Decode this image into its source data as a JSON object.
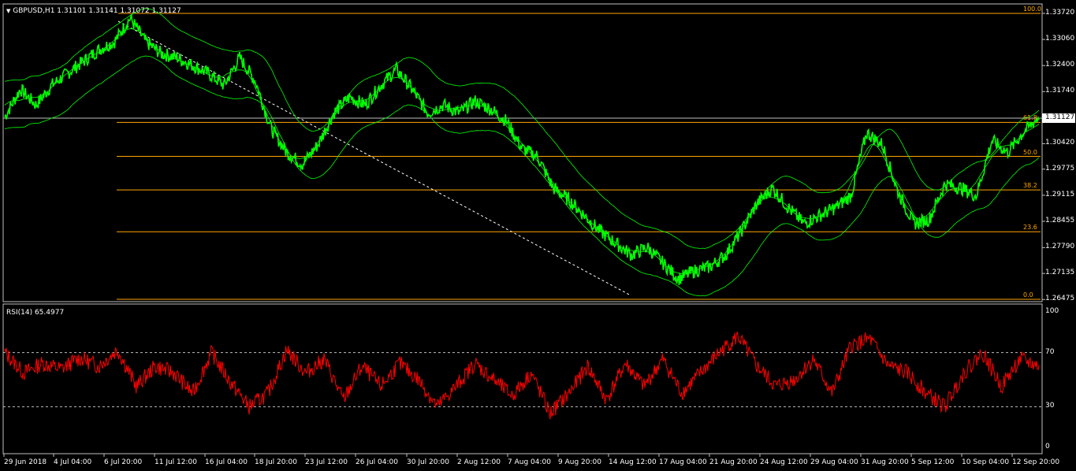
{
  "header": {
    "symbol_line": "GBPUSD,H1  1.31101 1.31141 1.31072 1.31127",
    "rsi_label": "RSI(14) 65.4977"
  },
  "price_axis": {
    "ticks": [
      "1.33720",
      "1.33060",
      "1.32400",
      "1.31740",
      "1.31127",
      "1.30420",
      "1.29775",
      "1.29115",
      "1.28455",
      "1.27790",
      "1.27135",
      "1.26475"
    ],
    "tick_values": [
      1.3372,
      1.3306,
      1.324,
      1.3174,
      1.31127,
      1.3042,
      1.29775,
      1.29115,
      1.28455,
      1.2779,
      1.27135,
      1.26475
    ],
    "current_price": "1.31127",
    "range": [
      1.2648,
      1.3372
    ]
  },
  "rsi_axis": {
    "ticks": [
      "100",
      "70",
      "30",
      "0"
    ],
    "levels": [
      70,
      30
    ]
  },
  "fib_levels": [
    {
      "label": "100.0",
      "price": 1.3372
    },
    {
      "label": "61.8",
      "price": 1.3096
    },
    {
      "label": "50.0",
      "price": 1.301
    },
    {
      "label": "38.2",
      "price": 1.2925
    },
    {
      "label": "23.6",
      "price": 1.2819
    },
    {
      "label": "0.0",
      "price": 1.2648
    }
  ],
  "time_axis": [
    "29 Jun 2018",
    "4 Jul 04:00",
    "6 Jul 20:00",
    "11 Jul 12:00",
    "16 Jul 04:00",
    "18 Jul 20:00",
    "23 Jul 12:00",
    "26 Jul 04:00",
    "30 Jul 20:00",
    "2 Aug 12:00",
    "7 Aug 04:00",
    "9 Aug 20:00",
    "14 Aug 12:00",
    "17 Aug 04:00",
    "21 Aug 20:00",
    "24 Aug 12:00",
    "29 Aug 04:00",
    "31 Aug 20:00",
    "5 Sep 12:00",
    "10 Sep 04:00",
    "12 Sep 20:00"
  ],
  "colors": {
    "price_line": "#00ff00",
    "bands": "#00ff00",
    "rsi_line": "#ff0000",
    "fib": "#ffa500",
    "grid_level": "#ffffff",
    "frame": "#c0c0c0"
  },
  "chart_data": {
    "type": "line",
    "title": "GBPUSD,H1",
    "series": [
      {
        "name": "GBPUSD,H1",
        "values": [
          1.311,
          1.318,
          1.314,
          1.319,
          1.322,
          1.325,
          1.328,
          1.33,
          1.336,
          1.33,
          1.327,
          1.326,
          1.324,
          1.322,
          1.319,
          1.326,
          1.32,
          1.308,
          1.302,
          1.299,
          1.304,
          1.312,
          1.316,
          1.314,
          1.319,
          1.323,
          1.318,
          1.312,
          1.314,
          1.312,
          1.315,
          1.313,
          1.31,
          1.303,
          1.301,
          1.293,
          1.29,
          1.286,
          1.282,
          1.279,
          1.276,
          1.278,
          1.274,
          1.27,
          1.272,
          1.273,
          1.276,
          1.282,
          1.289,
          1.293,
          1.288,
          1.284,
          1.286,
          1.288,
          1.291,
          1.307,
          1.304,
          1.292,
          1.284,
          1.285,
          1.294,
          1.293,
          1.291,
          1.305,
          1.302,
          1.307,
          1.311
        ]
      },
      {
        "name": "RSI(14)",
        "values": [
          70,
          55,
          62,
          58,
          66,
          60,
          72,
          45,
          60,
          55,
          40,
          70,
          48,
          30,
          40,
          72,
          55,
          65,
          35,
          60,
          45,
          62,
          50,
          30,
          45,
          62,
          50,
          38,
          55,
          25,
          40,
          60,
          35,
          62,
          45,
          65,
          40,
          55,
          70,
          82,
          60,
          45,
          50,
          65,
          40,
          75,
          80,
          60,
          55,
          40,
          30,
          55,
          70,
          45,
          65,
          60
        ]
      }
    ],
    "ylim": [
      1.2648,
      1.3372
    ]
  }
}
